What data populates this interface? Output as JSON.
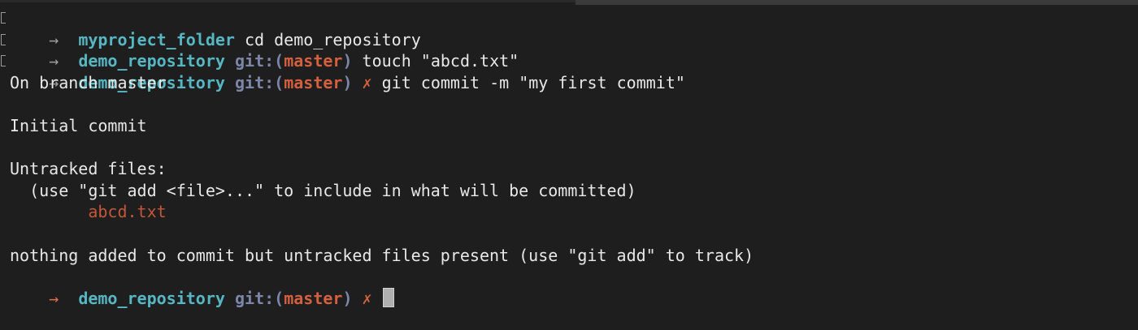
{
  "colors": {
    "background": "#1e1e1e",
    "directory": "#56b6c2",
    "git_label": "#7c86a8",
    "branch": "#d4603f",
    "untracked_file": "#c5563a",
    "text": "#e8e8e8"
  },
  "prompt_arrow": "→",
  "git_prefix": "git:(",
  "git_suffix": ")",
  "dirty_marker": "✗",
  "history": [
    {
      "dir": "myproject_folder",
      "command": "cd demo_repository"
    },
    {
      "dir": "demo_repository",
      "branch": "master",
      "command": "touch \"abcd.txt\""
    },
    {
      "dir": "demo_repository",
      "branch": "master",
      "command": "git commit -m \"my first commit\""
    }
  ],
  "output": {
    "on_branch": "On branch master",
    "initial_commit": "Initial commit",
    "untracked_header": "Untracked files:",
    "untracked_hint": "  (use \"git add <file>...\" to include in what will be committed)",
    "untracked_file": "        abcd.txt",
    "summary": "nothing added to commit but untracked files present (use \"git add\" to track)"
  },
  "current_prompt": {
    "dir": "demo_repository",
    "branch": "master"
  }
}
